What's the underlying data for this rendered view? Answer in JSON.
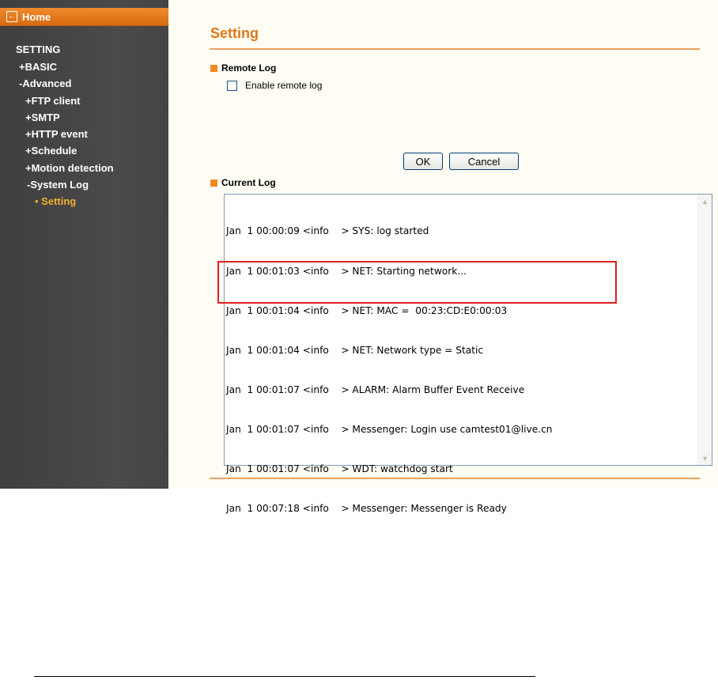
{
  "sidebar": {
    "home_label": "Home",
    "items": [
      {
        "label": "SETTING"
      },
      {
        "label": "+BASIC"
      },
      {
        "label": "-Advanced"
      },
      {
        "label": "+FTP client"
      },
      {
        "label": "+SMTP"
      },
      {
        "label": "+HTTP event"
      },
      {
        "label": "+Schedule"
      },
      {
        "label": "+Motion detection"
      },
      {
        "label": "-System Log"
      },
      {
        "label": "• Setting"
      }
    ]
  },
  "main": {
    "title": "Setting",
    "remote_log": {
      "heading": "Remote Log",
      "enable_label": "Enable remote log",
      "enabled": false
    },
    "buttons": {
      "ok": "OK",
      "cancel": "Cancel"
    },
    "current_log": {
      "heading": "Current Log",
      "lines": [
        "Jan  1 00:00:09 <info    > SYS: log started",
        "Jan  1 00:01:03 <info    > NET: Starting network...",
        "Jan  1 00:01:04 <info    > NET: MAC =  00:23:CD:E0:00:03",
        "Jan  1 00:01:04 <info    > NET: Network type = Static",
        "Jan  1 00:01:07 <info    > ALARM: Alarm Buffer Event Receive",
        "Jan  1 00:01:07 <info    > Messenger: Login use camtest01@live.cn",
        "Jan  1 00:01:07 <info    > WDT: watchdog start",
        "Jan  1 00:07:18 <info    > Messenger: Messenger is Ready"
      ]
    }
  },
  "colors": {
    "accent": "#e07818",
    "sidebar_bg": "#444444",
    "active_nav": "#f0b030",
    "highlight": "#e02020"
  }
}
